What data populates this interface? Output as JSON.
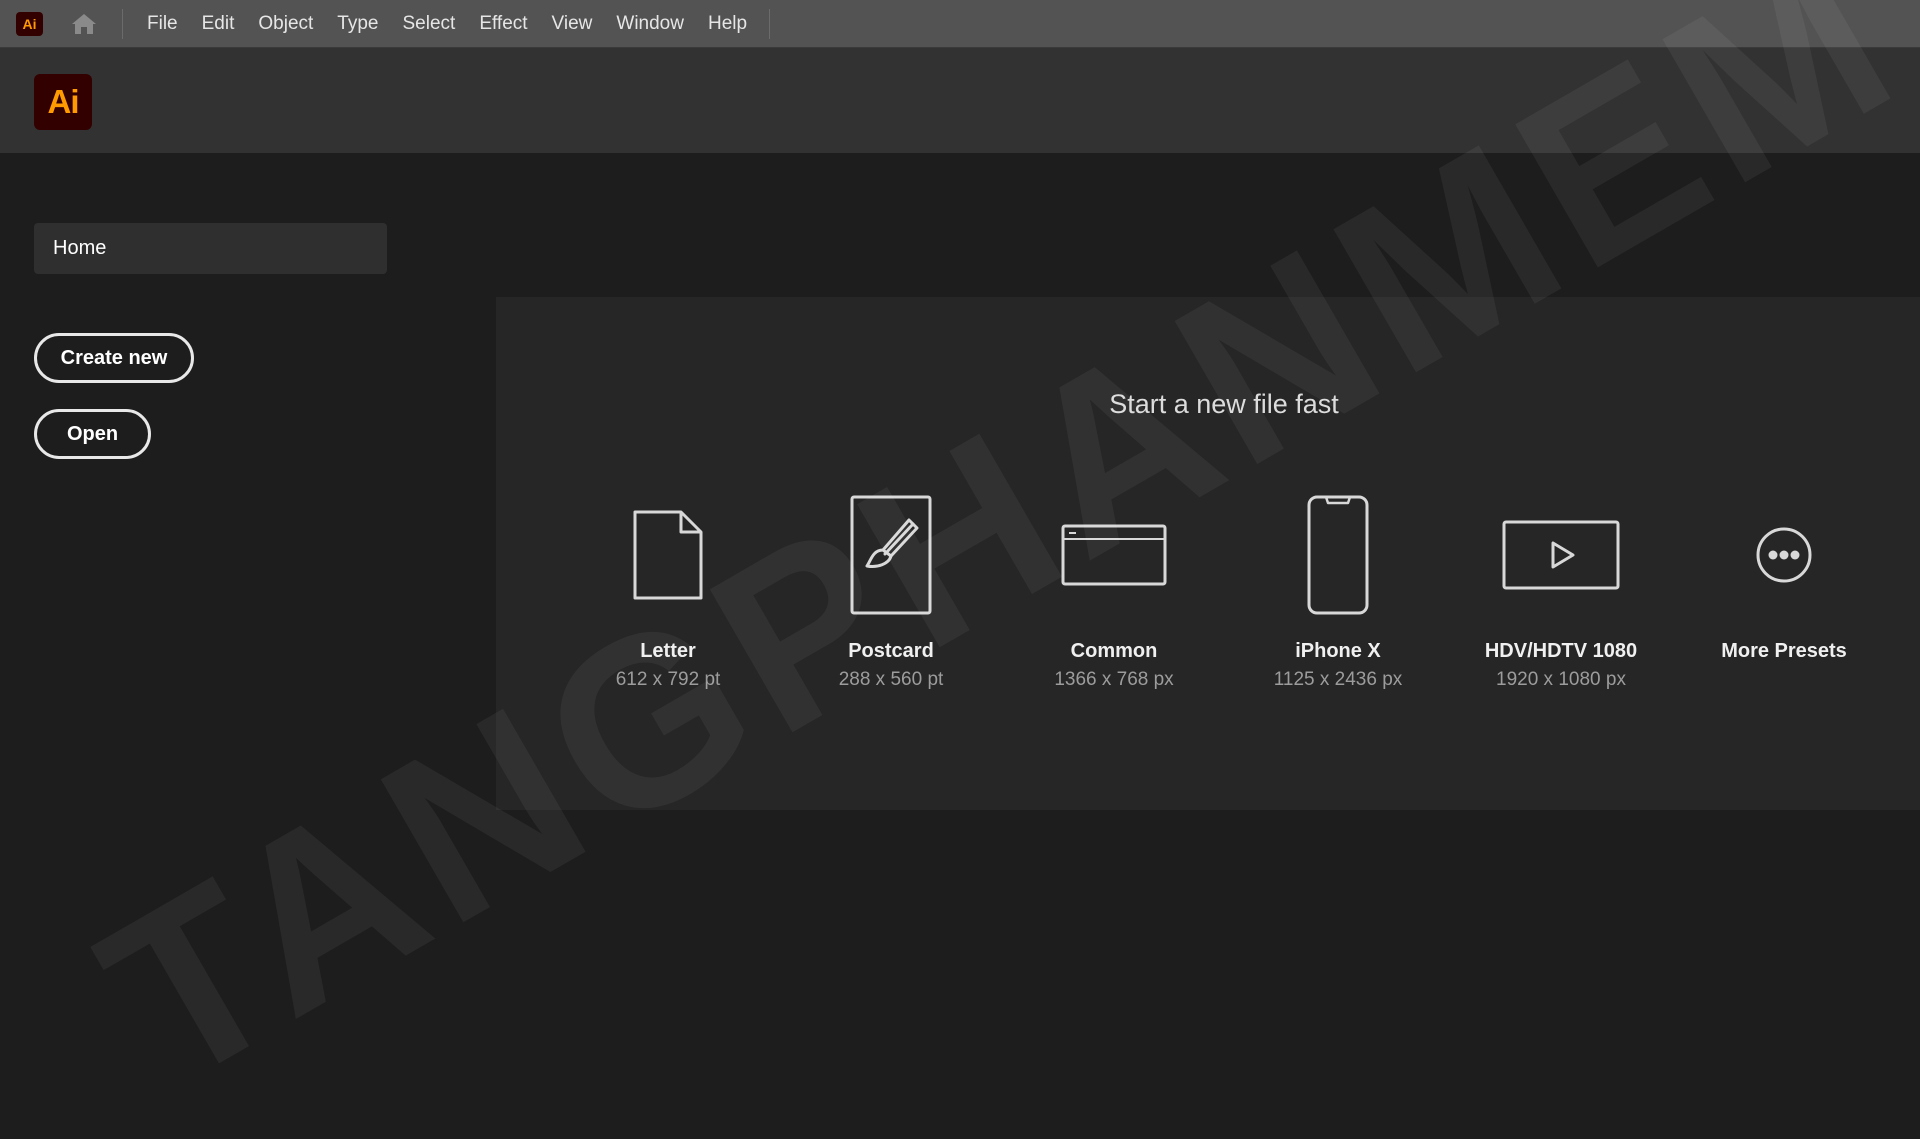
{
  "app": {
    "mini_logo": "Ai",
    "logo": "Ai",
    "accent_color": "#ff9a00",
    "logo_bg": "#330000"
  },
  "menubar": {
    "items": [
      "File",
      "Edit",
      "Object",
      "Type",
      "Select",
      "Effect",
      "View",
      "Window",
      "Help"
    ]
  },
  "sidebar": {
    "home_label": "Home",
    "create_new_label": "Create new",
    "open_label": "Open"
  },
  "main": {
    "title": "Start a new file fast",
    "presets": [
      {
        "name": "Letter",
        "size": "612 x 792 pt",
        "icon": "document-icon"
      },
      {
        "name": "Postcard",
        "size": "288 x 560 pt",
        "icon": "brush-icon"
      },
      {
        "name": "Common",
        "size": "1366 x 768 px",
        "icon": "browser-window-icon"
      },
      {
        "name": "iPhone X",
        "size": "1125 x 2436 px",
        "icon": "phone-icon"
      },
      {
        "name": "HDV/HDTV 1080",
        "size": "1920 x 1080 px",
        "icon": "video-play-icon"
      },
      {
        "name": "More Presets",
        "size": "",
        "icon": "more-icon"
      }
    ]
  },
  "watermark": "TANGPHANMEM"
}
